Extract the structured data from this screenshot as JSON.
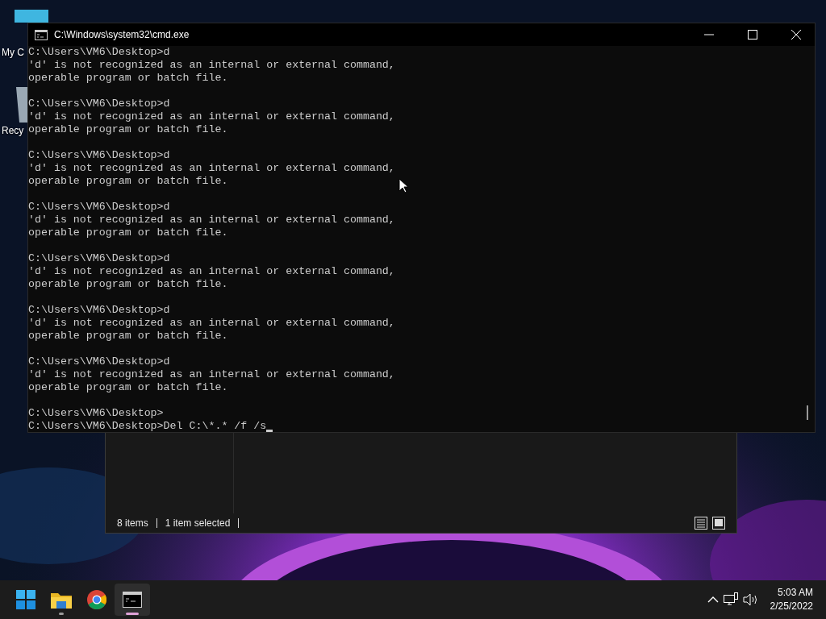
{
  "desktop_icons": [
    {
      "kind": "computer",
      "label": "My C"
    },
    {
      "kind": "recycle",
      "label": "Recy"
    }
  ],
  "explorer": {
    "status_bar": {
      "count": "8 items",
      "selection": "1 item selected"
    }
  },
  "cmd": {
    "title": "C:\\Windows\\system32\\cmd.exe",
    "blocks": [
      {
        "lines": [
          "C:\\Users\\VM6\\Desktop>d",
          "'d' is not recognized as an internal or external command,",
          "operable program or batch file."
        ]
      },
      {
        "lines": [
          "C:\\Users\\VM6\\Desktop>d",
          "'d' is not recognized as an internal or external command,",
          "operable program or batch file."
        ]
      },
      {
        "lines": [
          "C:\\Users\\VM6\\Desktop>d",
          "'d' is not recognized as an internal or external command,",
          "operable program or batch file."
        ]
      },
      {
        "lines": [
          "C:\\Users\\VM6\\Desktop>d",
          "'d' is not recognized as an internal or external command,",
          "operable program or batch file."
        ]
      },
      {
        "lines": [
          "C:\\Users\\VM6\\Desktop>d",
          "'d' is not recognized as an internal or external command,",
          "operable program or batch file."
        ]
      },
      {
        "lines": [
          "C:\\Users\\VM6\\Desktop>d",
          "'d' is not recognized as an internal or external command,",
          "operable program or batch file."
        ]
      },
      {
        "lines": [
          "C:\\Users\\VM6\\Desktop>d",
          "'d' is not recognized as an internal or external command,",
          "operable program or batch file."
        ]
      },
      {
        "lines": [
          "C:\\Users\\VM6\\Desktop>",
          "C:\\Users\\VM6\\Desktop>Del C:\\*.* /f /s"
        ]
      }
    ]
  },
  "taskbar": {
    "items": [
      {
        "kind": "start",
        "running": false,
        "active": false
      },
      {
        "kind": "explorer",
        "running": true,
        "active": false
      },
      {
        "kind": "chrome",
        "running": false,
        "active": false
      },
      {
        "kind": "terminal",
        "running": true,
        "active": true
      }
    ],
    "time": "5:03 AM",
    "date": "2/25/2022"
  }
}
